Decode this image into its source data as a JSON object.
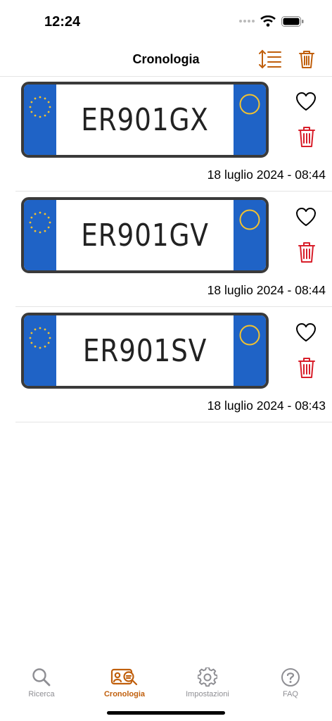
{
  "status": {
    "time": "12:24"
  },
  "header": {
    "title": "Cronologia"
  },
  "items": [
    {
      "plate": "ER901GX",
      "date": "18 luglio 2024 - 08:44"
    },
    {
      "plate": "ER901GV",
      "date": "18 luglio 2024 - 08:44"
    },
    {
      "plate": "ER901SV",
      "date": "18 luglio 2024 - 08:43"
    }
  ],
  "tabs": [
    {
      "label": "Ricerca",
      "icon": "search-icon"
    },
    {
      "label": "Cronologia",
      "icon": "history-icon",
      "active": true
    },
    {
      "label": "Impostazioni",
      "icon": "gear-icon"
    },
    {
      "label": "FAQ",
      "icon": "question-icon"
    }
  ],
  "colors": {
    "accent": "#c05f0c",
    "delete": "#d81e2a",
    "plate_blue": "#1f63c6",
    "stars": "#f2c230",
    "inactive_tab": "#8e8e93"
  }
}
